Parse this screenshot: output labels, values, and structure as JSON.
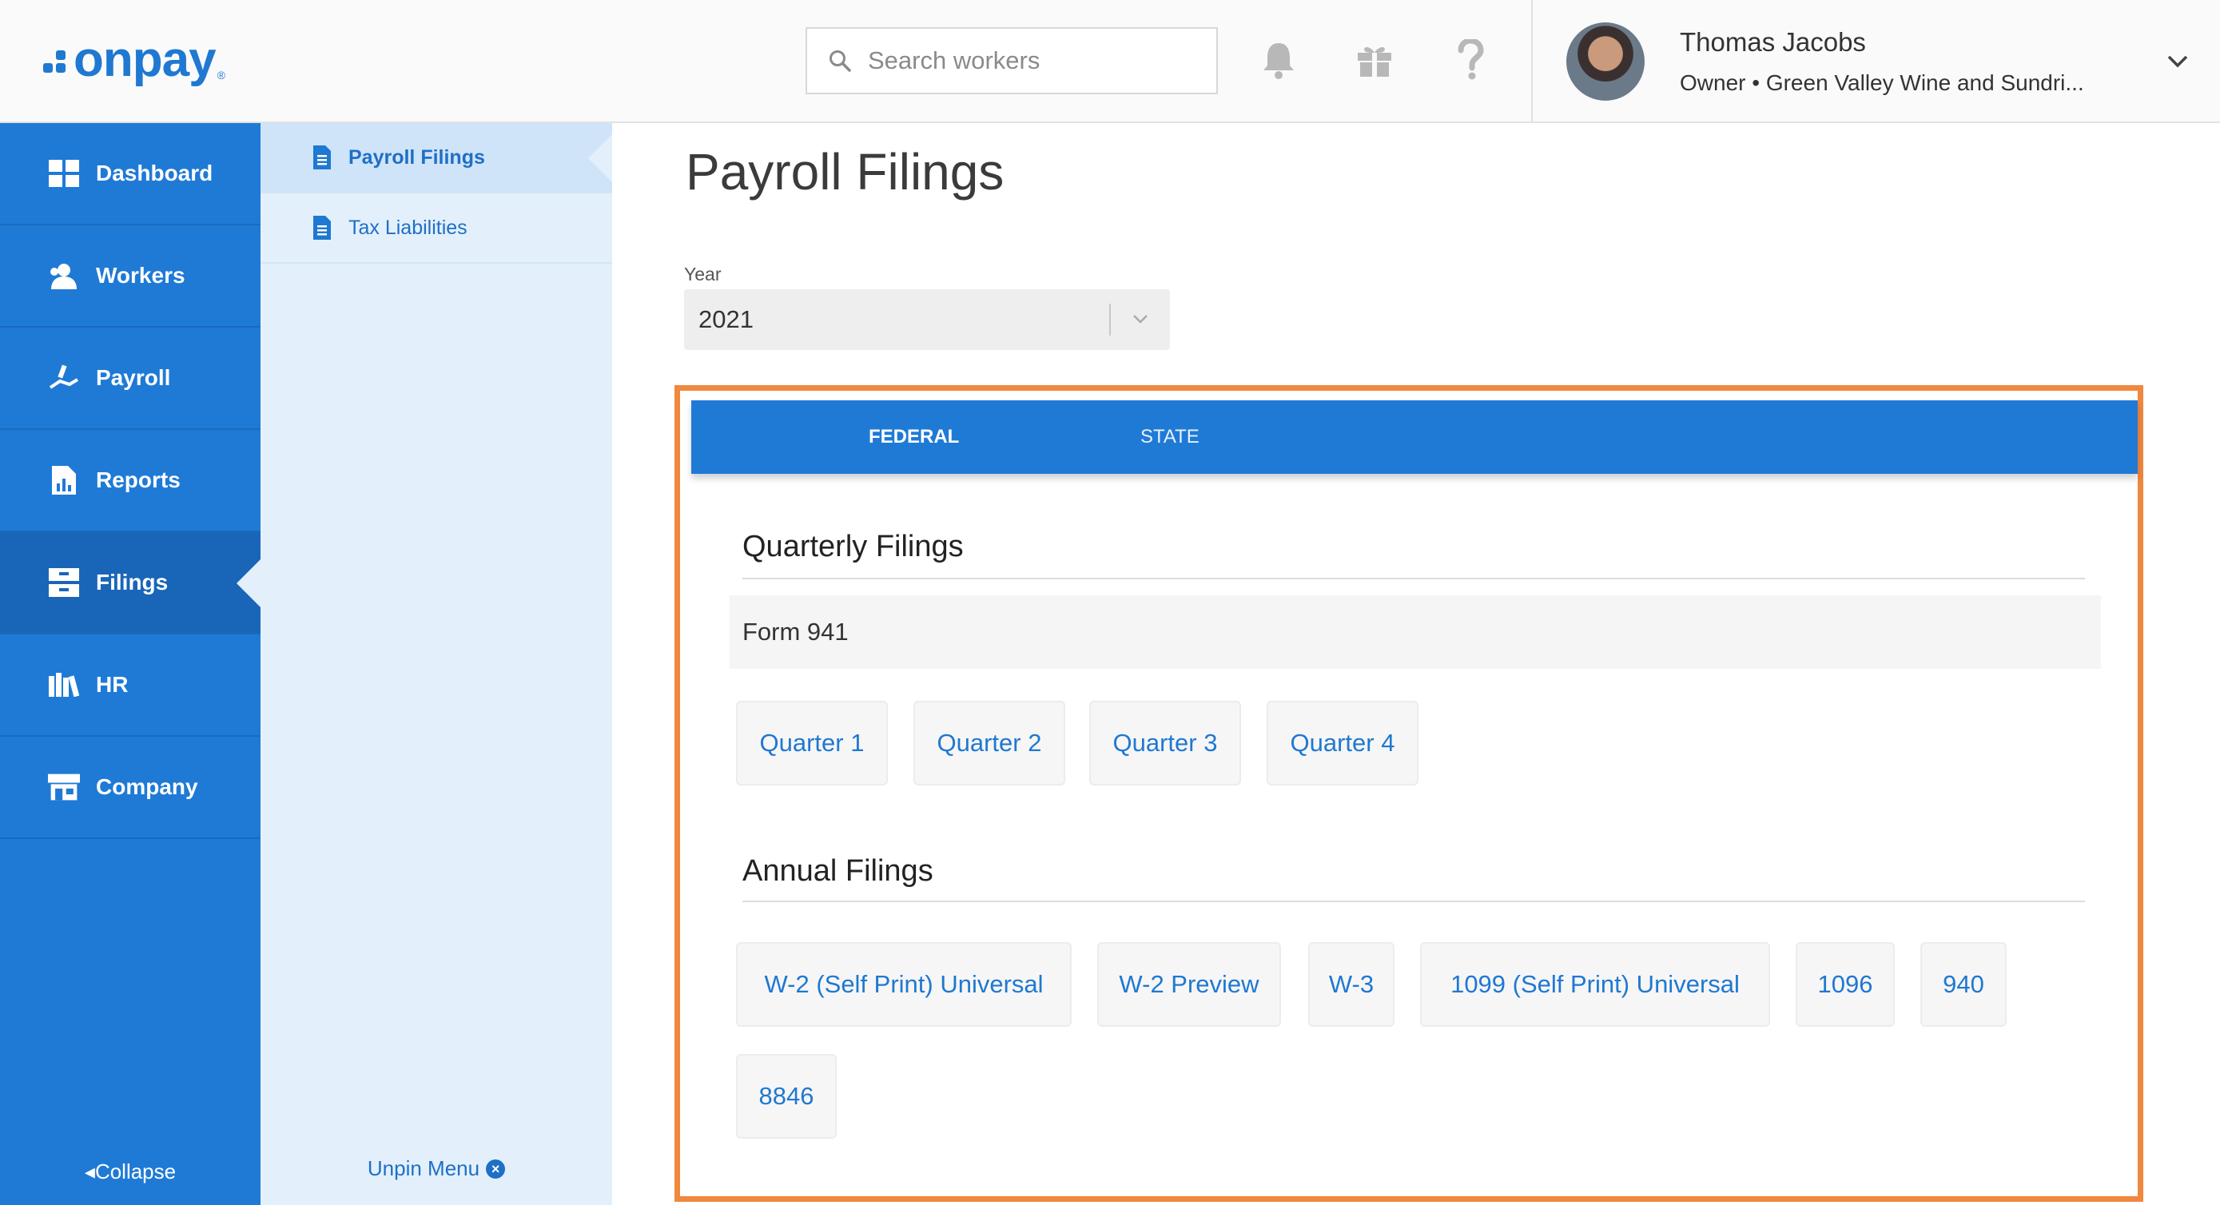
{
  "brand": {
    "name": "onpay",
    "reg": "®",
    "color": "#1f78d1"
  },
  "header": {
    "search_placeholder": "Search workers",
    "user_name": "Thomas Jacobs",
    "user_subtitle": "Owner • Green Valley Wine and Sundri..."
  },
  "sidebar": {
    "items": [
      {
        "label": "Dashboard",
        "icon": "grid-icon"
      },
      {
        "label": "Workers",
        "icon": "users-icon"
      },
      {
        "label": "Payroll",
        "icon": "payroll-hand-icon"
      },
      {
        "label": "Reports",
        "icon": "report-chart-icon"
      },
      {
        "label": "Filings",
        "icon": "filing-cabinet-icon",
        "active": true
      },
      {
        "label": "HR",
        "icon": "books-icon"
      },
      {
        "label": "Company",
        "icon": "storefront-icon"
      }
    ],
    "collapse_label": "Collapse"
  },
  "subnav": {
    "items": [
      {
        "label": "Payroll Filings",
        "active": true
      },
      {
        "label": "Tax Liabilities"
      }
    ],
    "unpin_label": "Unpin Menu"
  },
  "main": {
    "title": "Payroll Filings",
    "year_label": "Year",
    "year_value": "2021",
    "tabs": [
      {
        "label": "FEDERAL",
        "active": true
      },
      {
        "label": "STATE"
      }
    ],
    "quarterly": {
      "title": "Quarterly Filings",
      "form_label": "Form 941",
      "buttons": [
        "Quarter 1",
        "Quarter 2",
        "Quarter 3",
        "Quarter 4"
      ]
    },
    "annual": {
      "title": "Annual Filings",
      "buttons": [
        "W-2 (Self Print) Universal",
        "W-2 Preview",
        "W-3",
        "1099 (Self Print) Universal",
        "1096",
        "940",
        "8846"
      ]
    }
  },
  "colors": {
    "primary": "#1f7ad6",
    "highlight_frame": "#f0883e",
    "subnav_bg": "#e3f0fc"
  }
}
